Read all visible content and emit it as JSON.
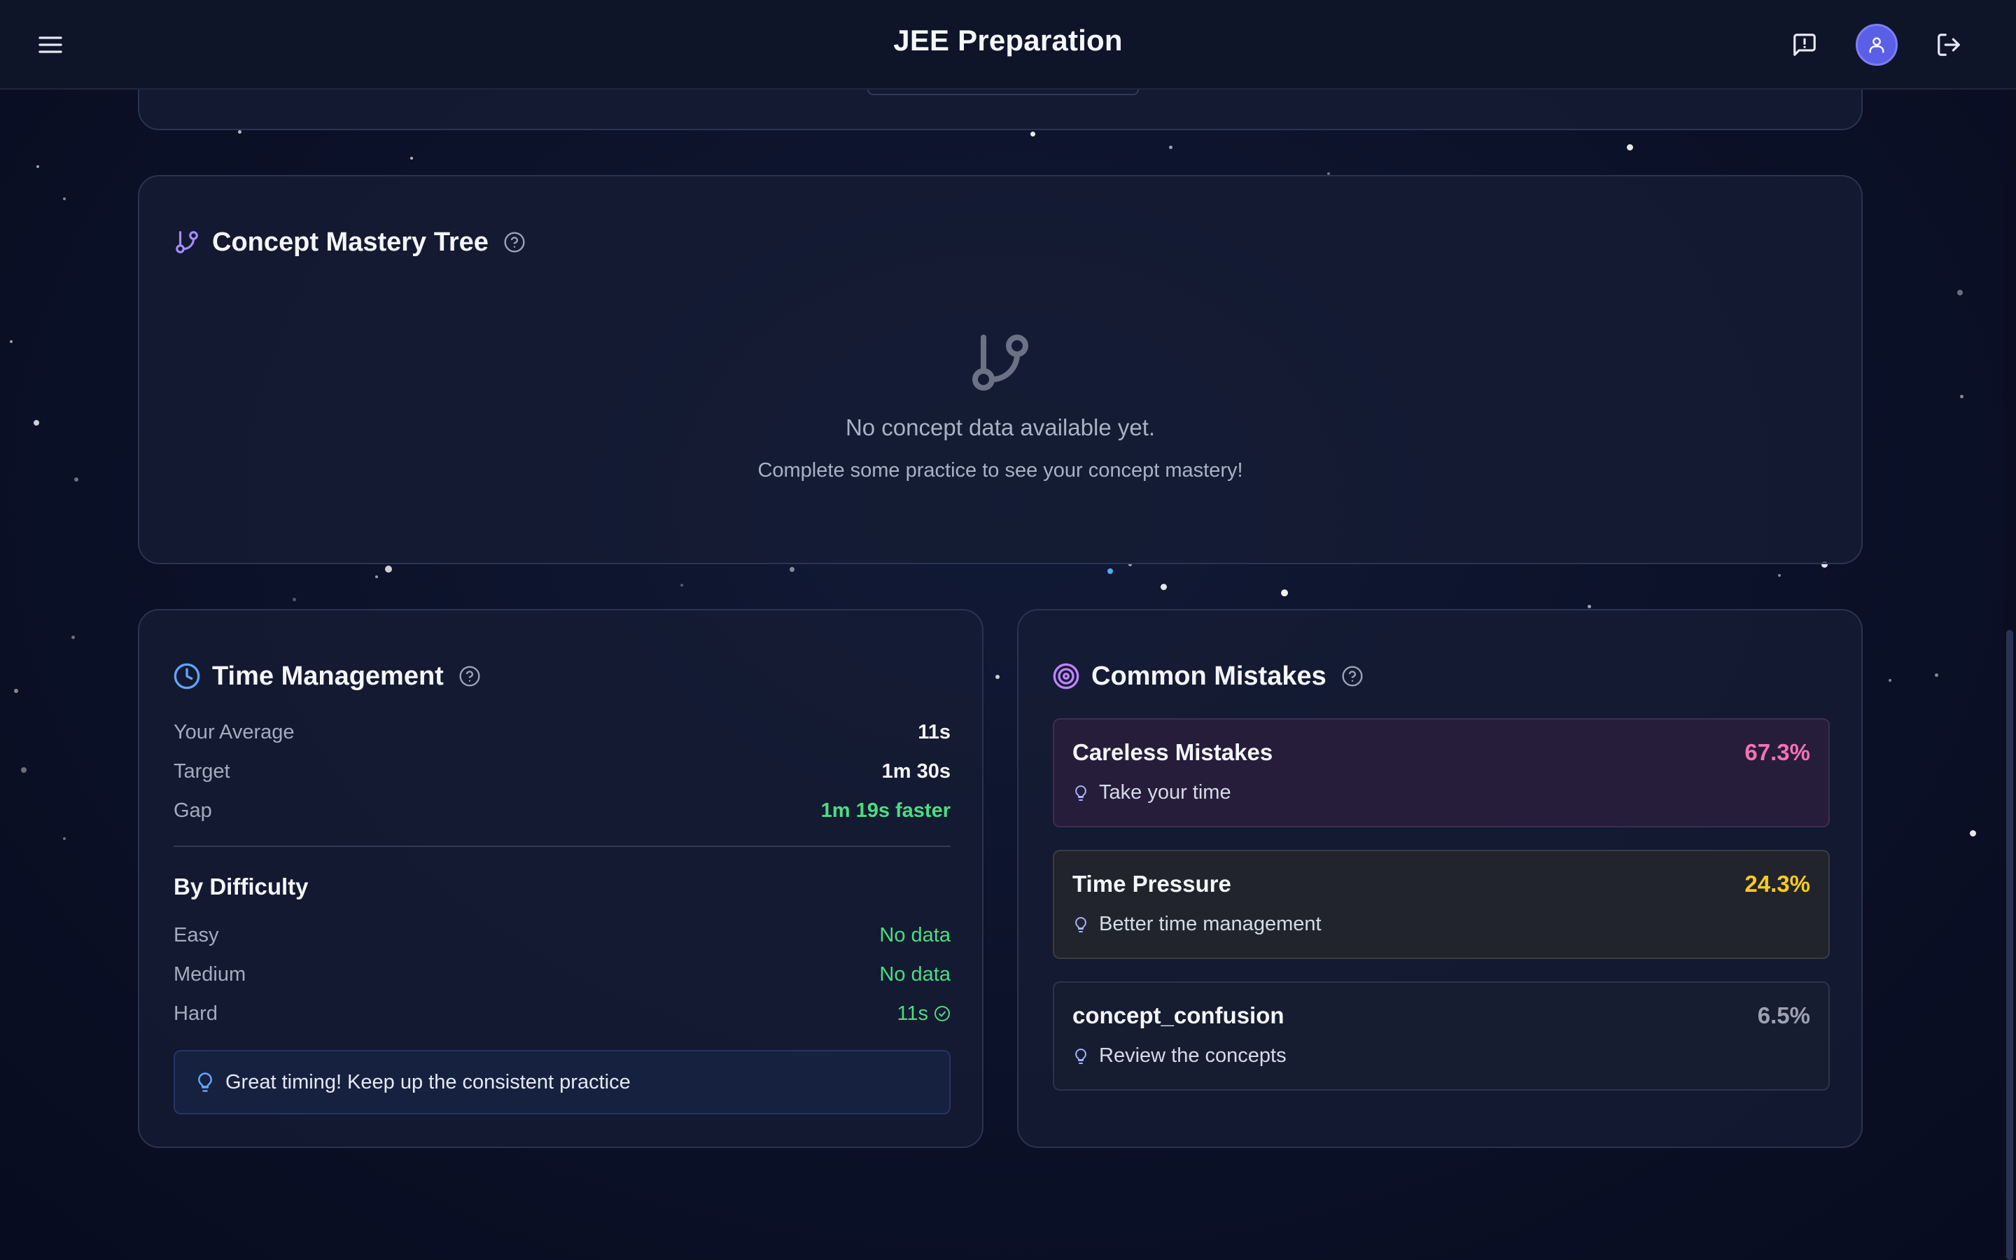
{
  "header": {
    "title": "JEE Preparation",
    "menu_icon": "hamburger-icon",
    "feedback_icon": "message-alert-icon",
    "avatar_icon": "user-icon",
    "logout_icon": "log-out-icon"
  },
  "concept_mastery": {
    "title": "Concept Mastery Tree",
    "icon": "git-branch-icon",
    "help_icon": "help-circle-icon",
    "empty_title": "No concept data available yet.",
    "empty_subtitle": "Complete some practice to see your concept mastery!"
  },
  "time_management": {
    "title": "Time Management",
    "icon": "clock-icon",
    "help_icon": "help-circle-icon",
    "stats": [
      {
        "label": "Your Average",
        "value": "11s"
      },
      {
        "label": "Target",
        "value": "1m 30s"
      },
      {
        "label": "Gap",
        "value": "1m 19s faster"
      }
    ],
    "by_difficulty_title": "By Difficulty",
    "difficulty": [
      {
        "label": "Easy",
        "value": "No data"
      },
      {
        "label": "Medium",
        "value": "No data"
      },
      {
        "label": "Hard",
        "value": "11s"
      }
    ],
    "tip": "Great timing! Keep up the consistent practice"
  },
  "common_mistakes": {
    "title": "Common Mistakes",
    "icon": "target-icon",
    "help_icon": "help-circle-icon",
    "items": [
      {
        "name": "Careless Mistakes",
        "percent": "67.3%",
        "tip": "Take your time",
        "color": "#f472b6"
      },
      {
        "name": "Time Pressure",
        "percent": "24.3%",
        "tip": "Better time management",
        "color": "#facc15"
      },
      {
        "name": "concept_confusion",
        "percent": "6.5%",
        "tip": "Review the concepts",
        "color": "#9ca3af"
      }
    ]
  },
  "colors": {
    "accent_purple": "#a78bfa",
    "accent_blue": "#60a5fa",
    "success_green": "#4ade80",
    "avatar_bg": "#5b5fe6"
  }
}
